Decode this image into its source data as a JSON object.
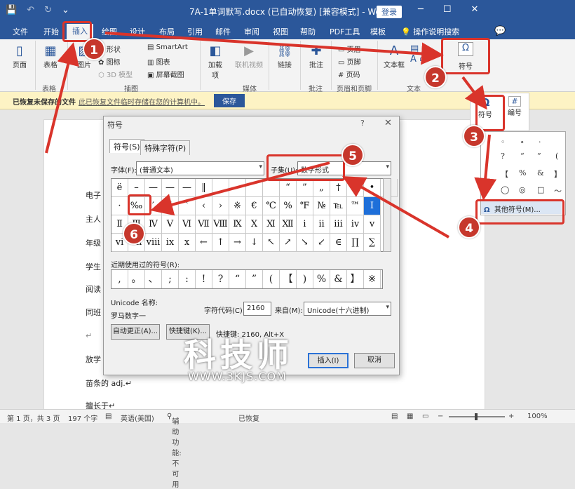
{
  "window": {
    "title": "7A-1单词默写.docx (已自动恢复) [兼容模式] - Word",
    "login": "登录",
    "controls": [
      "─",
      "☐",
      "✕"
    ]
  },
  "quick_access": [
    "💾",
    "↶",
    "↻",
    "⌄"
  ],
  "tabs": [
    "文件",
    "开始",
    "插入",
    "绘图",
    "设计",
    "布局",
    "引用",
    "邮件",
    "审阅",
    "视图",
    "帮助",
    "PDF工具",
    "模板",
    "操作说明搜索"
  ],
  "ribbon": {
    "page": "页面",
    "table": "表格",
    "picture": "图片",
    "shapes": "形状",
    "icons": "图标",
    "models3d": "3D 模型",
    "smartart": "SmartArt",
    "chart": "图表",
    "screenshot": "屏幕截图",
    "addins": "加载项",
    "online_video": "联机视频",
    "link": "链接",
    "comment": "批注",
    "header": "页眉",
    "footer": "页脚",
    "pagenum": "页码",
    "textbox": "文本框",
    "symbol": "符号",
    "groups": [
      "表格",
      "插图",
      "媒体",
      "批注",
      "页眉和页脚",
      "文本"
    ]
  },
  "infobar": {
    "title": "已恢复未保存的文件",
    "message": "此已恢复文件临时存储在您的计算机中。",
    "save": "保存"
  },
  "document_lines": [
    "电子",
    "主人",
    "年级",
    "学生",
    "阅读",
    "同班",
    "↵",
    "放学",
    "苗条的 adj.↵",
    "擅长于↵"
  ],
  "symbol_panel": {
    "symbol_label": "符号",
    "number_label": "编号",
    "recent": [
      "◦",
      "∘",
      "·",
      "·",
      "·",
      "?",
      "“",
      "”",
      "(",
      "【",
      "%",
      "&",
      "】",
      "◯",
      "◎",
      "□",
      "～"
    ],
    "more": "其他符号(M)..."
  },
  "dialog": {
    "title": "符号",
    "help": "?",
    "close": "✕",
    "tab_symbols": "符号(S)",
    "tab_special": "特殊字符(P)",
    "font_label": "字体(F):",
    "font_value": "(普通文本)",
    "subset_label": "子集(U):",
    "subset_value": "数字形式",
    "grid": [
      [
        "ë",
        "–",
        "—",
        "—",
        "—",
        "‖",
        "",
        "",
        "",
        "",
        "“",
        "”",
        "„",
        "†",
        "‡",
        "•",
        ""
      ],
      [
        "·",
        "‰",
        "′",
        "″",
        "‵",
        "‹",
        "›",
        "※",
        "€",
        "℃",
        "%",
        "℉",
        "№",
        "℡",
        "™",
        "Ⅰ"
      ],
      [
        "Ⅱ",
        "Ⅲ",
        "Ⅳ",
        "Ⅴ",
        "Ⅵ",
        "Ⅶ",
        "Ⅷ",
        "Ⅸ",
        "Ⅹ",
        "Ⅺ",
        "Ⅻ",
        "ⅰ",
        "ⅱ",
        "ⅲ",
        "ⅳ",
        "ⅴ"
      ],
      [
        "ⅵ",
        "ⅶ",
        "ⅷ",
        "ⅸ",
        "ⅹ",
        "←",
        "↑",
        "→",
        "↓",
        "↖",
        "↗",
        "↘",
        "↙",
        "∈",
        "∏",
        "∑"
      ]
    ],
    "recent_label": "近期使用过的符号(R):",
    "recent": [
      ",",
      "。",
      "、",
      ";",
      ":",
      "!",
      "?",
      "“",
      "”",
      "(",
      "【",
      ")",
      "%",
      "&",
      "】",
      "※"
    ],
    "unicode_name_label": "Unicode 名称:",
    "unicode_name": "罗马数字一",
    "char_code_label": "字符代码(C):",
    "char_code": "2160",
    "from_label": "来自(M):",
    "from_value": "Unicode(十六进制)",
    "autocorrect": "自动更正(A)...",
    "shortcut_btn": "快捷键(K)...",
    "shortcut_text": "快捷键: 2160, Alt+X",
    "insert": "插入(I)",
    "cancel": "取消"
  },
  "status": {
    "page": "第 1 页，共 3 页",
    "words": "197 个字",
    "lang": "英语(美国)",
    "access": "辅助功能: 不可用",
    "recovered": "已恢复",
    "zoom": "100%"
  },
  "markers": [
    "1",
    "2",
    "3",
    "4",
    "5",
    "6"
  ],
  "watermark": {
    "main": "科技师",
    "url": "WWW.3KJS.COM"
  },
  "colors": {
    "accent": "#2b579a",
    "highlight": "#d9342b",
    "selected": "#1e6fd9"
  }
}
